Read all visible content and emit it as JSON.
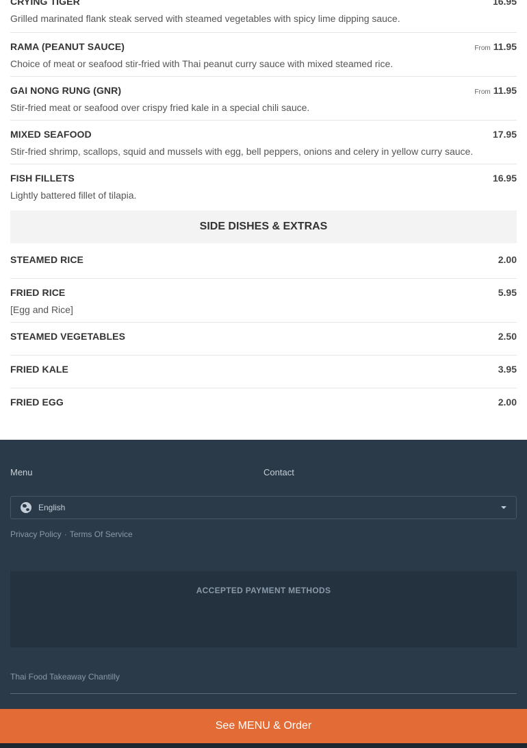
{
  "menu_items_top": [
    {
      "name": "CRYING TIGER",
      "price": "16.95",
      "from": "",
      "desc": "Grilled marinated flank steak served with steamed vegetables with spicy lime dipping sauce."
    },
    {
      "name": "RAMA (PEANUT SAUCE)",
      "price": "11.95",
      "from": "From",
      "desc": "Choice of meat or seafood stir-fried with Thai peanut curry sauce with mixed steamed rice."
    },
    {
      "name": "GAI NONG RUNG (GNR)",
      "price": "11.95",
      "from": "From",
      "desc": "Stir-fried meat or seafood over crispy fried kale in a special chili sauce."
    },
    {
      "name": "MIXED SEAFOOD",
      "price": "17.95",
      "from": "",
      "desc": "Stir-fried shrimp, scallops, squid and mussels with egg, bell peppers, onions and celery in yellow curry sauce."
    },
    {
      "name": "FISH FILLETS",
      "price": "16.95",
      "from": "",
      "desc": "Lightly battered fillet of tilapia."
    }
  ],
  "section": {
    "title": "SIDE DISHES & EXTRAS"
  },
  "side_items": [
    {
      "name": "STEAMED RICE",
      "price": "2.00",
      "desc": ""
    },
    {
      "name": "FRIED RICE",
      "price": "5.95",
      "desc": "[Egg and Rice]"
    },
    {
      "name": "STEAMED VEGETABLES",
      "price": "2.50",
      "desc": ""
    },
    {
      "name": "FRIED KALE",
      "price": "3.95",
      "desc": ""
    },
    {
      "name": "FRIED EGG",
      "price": "2.00",
      "desc": ""
    }
  ],
  "footer": {
    "menu_link": "Menu",
    "contact_link": "Contact",
    "language": "English",
    "privacy": "Privacy Policy",
    "separator": "·",
    "terms": "Terms Of Service",
    "payment_title": "ACCEPTED PAYMENT METHODS",
    "brand": "Thai Food Takeaway Chantilly"
  },
  "cta": {
    "label": "See MENU & Order"
  },
  "colors": {
    "accent": "#e36b35",
    "footer_bg": "#2b3a48"
  },
  "icons": {
    "language": "globe-icon",
    "dropdown": "caret-down-icon"
  }
}
